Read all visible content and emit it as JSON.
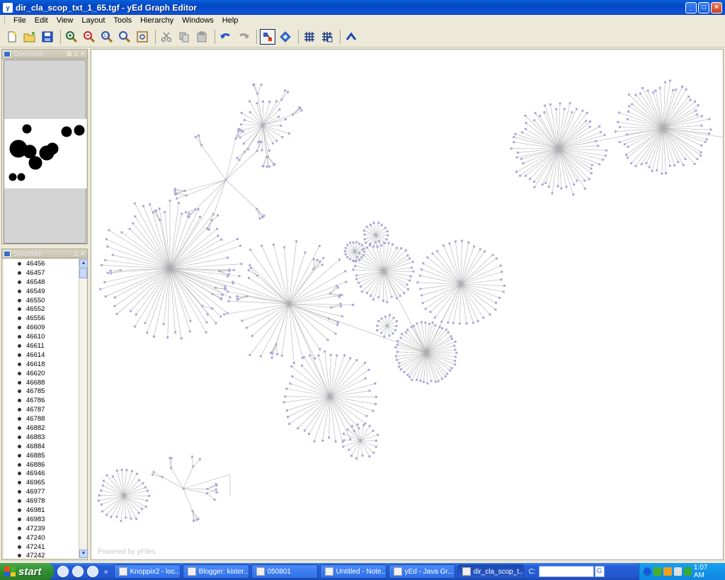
{
  "window": {
    "title": "dir_cla_scop_txt_1_65.tgf - yEd Graph Editor",
    "app_icon": "yed-icon",
    "controls": {
      "minimize": "_",
      "maximize": "□",
      "close": "×"
    }
  },
  "menu": [
    "File",
    "Edit",
    "View",
    "Layout",
    "Tools",
    "Hierarchy",
    "Windows",
    "Help"
  ],
  "toolbar": {
    "buttons": [
      "new-icon",
      "open-icon",
      "save-icon",
      "zoom-in-icon",
      "zoom-out-icon",
      "zoom-fit-icon",
      "zoom-icon",
      "fit-content-icon",
      "cut-icon",
      "copy-icon",
      "paste-icon",
      "undo-icon",
      "redo-icon",
      "edit-mode-icon",
      "navigate-icon",
      "grid-icon",
      "snap-grid-icon",
      "up-icon"
    ]
  },
  "overview": {
    "title": "Overview"
  },
  "structure": {
    "title": "Structure",
    "items": [
      "46456",
      "46457",
      "46548",
      "46549",
      "46550",
      "46552",
      "46556",
      "46609",
      "46610",
      "46611",
      "46614",
      "46618",
      "46620",
      "46688",
      "46785",
      "46786",
      "46787",
      "46788",
      "46882",
      "46883",
      "46884",
      "46885",
      "46886",
      "46946",
      "46965",
      "46977",
      "46978",
      "46981",
      "46983",
      "47239",
      "47240",
      "47241",
      "47242"
    ]
  },
  "canvas": {
    "watermark": "Powered by yFiles",
    "node_color": "#a8a8d8",
    "edge_color": "#b0b0b0"
  },
  "taskbar": {
    "start_label": "start",
    "chevron": "»",
    "tasks": [
      {
        "label": "Knoppix2 - loc...",
        "active": false
      },
      {
        "label": "Blogger: kister...",
        "active": false
      },
      {
        "label": "050801",
        "active": false
      },
      {
        "label": "Untitled - Note...",
        "active": false
      },
      {
        "label": "yEd - Java Gr...",
        "active": false
      },
      {
        "label": "dir_cla_scop_t...",
        "active": true
      }
    ],
    "address_label": "C:",
    "search_value": "",
    "google_label": "G",
    "clock": "1:07 AM"
  }
}
